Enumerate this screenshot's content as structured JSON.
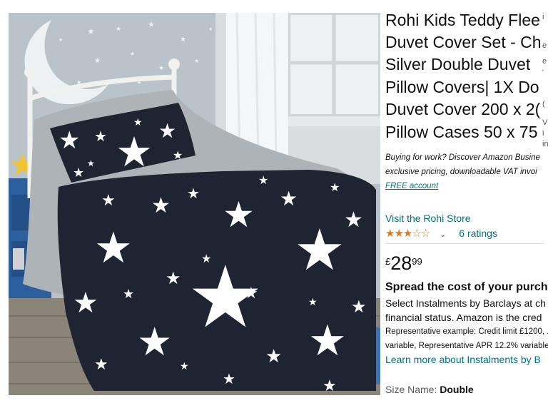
{
  "product": {
    "title_lines": [
      "Rohi Kids Teddy Flee",
      "Duvet Cover Set - Ch",
      "Silver Double Duvet",
      "Pillow Covers| 1X Do",
      "Duvet Cover 200 x 2(",
      "Pillow Cases 50 x 75"
    ],
    "edge_chars": [
      "i",
      "e",
      "e",
      "'",
      "(",
      "V",
      "i",
      "in"
    ],
    "business_promo": {
      "line1": "Buying for work? Discover Amazon Busine",
      "line2": "exclusive pricing, downloadable VAT invoi",
      "link": "FREE account"
    },
    "store_link": "Visit the Rohi Store",
    "rating": {
      "stars_value": 3,
      "stars_max": 5,
      "chevron": "⌄",
      "count_label": "6 ratings"
    },
    "price": {
      "symbol": "£",
      "whole": "28",
      "fraction": "99"
    },
    "instalments": {
      "heading": "Spread the cost of your purch",
      "line1": "Select Instalments by Barclays at ch",
      "line2": "financial status. Amazon is the cred",
      "line3": "Representative example: Credit limit £1200, .",
      "line4": "variable, Representative APR 12.2% variable",
      "link": "Learn more about Instalments by B"
    },
    "size": {
      "label": "Size Name:",
      "value": "Double"
    }
  },
  "colors": {
    "link": "#007185",
    "star": "#DE7921",
    "text": "#0F1111",
    "duvet_navy": "#1f2433",
    "wall": "#b7c1c8"
  }
}
